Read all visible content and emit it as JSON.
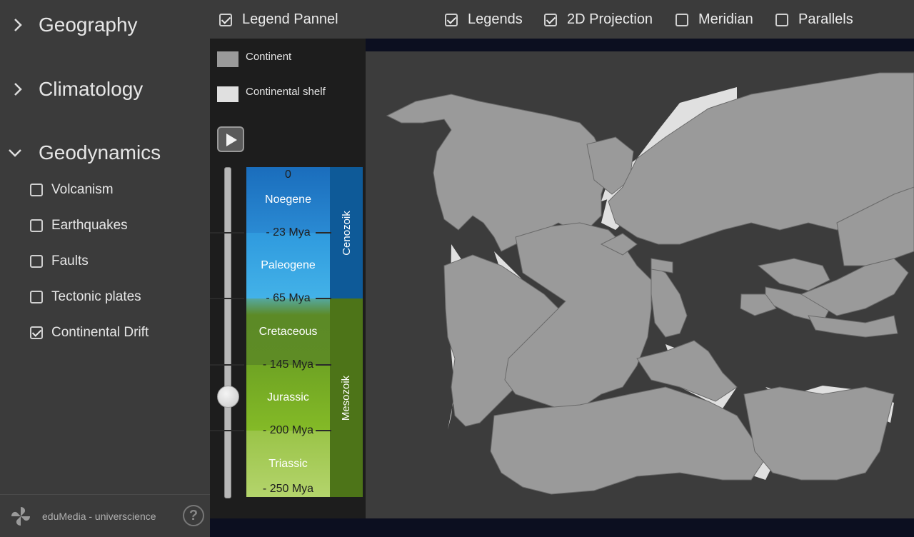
{
  "sidebar": {
    "sections": [
      {
        "label": "Geography",
        "expanded": false
      },
      {
        "label": "Climatology",
        "expanded": false
      },
      {
        "label": "Geodynamics",
        "expanded": true
      }
    ],
    "geodynamics_items": [
      {
        "label": "Volcanism",
        "checked": false
      },
      {
        "label": "Earthquakes",
        "checked": false
      },
      {
        "label": "Faults",
        "checked": false
      },
      {
        "label": "Tectonic plates",
        "checked": false
      },
      {
        "label": "Continental Drift",
        "checked": true
      }
    ],
    "footer": {
      "brand": "eduMedia - universcience",
      "help": "?"
    }
  },
  "topbar": {
    "legend_panel": {
      "label": "Legend Pannel",
      "checked": true
    },
    "legends": {
      "label": "Legends",
      "checked": true
    },
    "projection_2d": {
      "label": "2D Projection",
      "checked": true
    },
    "meridian": {
      "label": "Meridian",
      "checked": false
    },
    "parallels": {
      "label": "Parallels",
      "checked": false
    }
  },
  "legend": {
    "items": [
      {
        "label": "Continent",
        "color": "#9a9a9a"
      },
      {
        "label": "Continental shelf",
        "color": "#e0e0e0"
      }
    ]
  },
  "timeline": {
    "ticks": [
      "0",
      "- 23 Mya",
      "- 65 Mya",
      "- 145 Mya",
      "- 200 Mya",
      "- 250 Mya"
    ],
    "periods": [
      "Noegene",
      "Paleogene",
      "Cretaceous",
      "Jurassic",
      "Triassic"
    ],
    "eras": [
      "Cenozoik",
      "Mesozoik"
    ],
    "current_mya": 172,
    "colors": {
      "noegene": "#1f76c4",
      "paleogene": "#3aa6e2",
      "cenozoic": "#0e5a98",
      "cretaceous": "#5c8a26",
      "jurassic": "#7eb525",
      "triassic": "#a8cc5a",
      "mesozoic": "#4d7418"
    }
  },
  "map": {
    "background": "#3c3c3c",
    "continent_color": "#9a9a9a",
    "shelf_color": "#e0e0e0"
  }
}
